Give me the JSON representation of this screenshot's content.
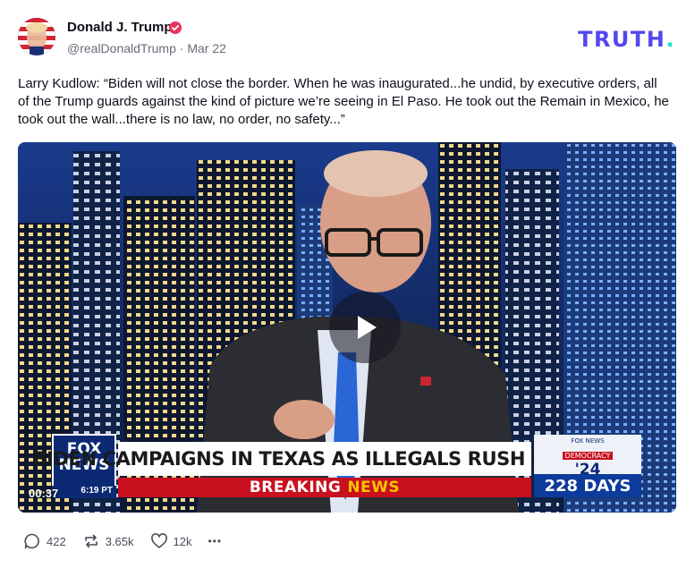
{
  "author": {
    "name": "Donald J. Trump",
    "handle": "@realDonaldTrump",
    "separator": "·",
    "date": "Mar 22"
  },
  "brand": {
    "text": "TRUTH",
    "dot": "."
  },
  "post": {
    "text": "Larry Kudlow: “Biden will not close the border. When he was inaugurated...he undid, by executive orders, all of the Trump guards against the kind of picture we’re seeing in El Paso. He took out the Remain in Mexico, he took out the wall...there is no law, no order, no safety...”"
  },
  "video": {
    "timestamp": "00:37",
    "chyron": {
      "headline": "BIDEN CAMPAIGNS IN TEXAS AS ILLEGALS RUSH BORDER",
      "breaking": "BREAKING",
      "news": "NEWS",
      "logo_line1": "FOX",
      "logo_line2": "NEWS",
      "time": "6:19 PT",
      "box_small": "FOX NEWS",
      "box_label": "DEMOCRACY",
      "box_year": "'24",
      "days": "228 DAYS"
    }
  },
  "actions": {
    "replies": "422",
    "retruths": "3.65k",
    "likes": "12k",
    "more": "•••"
  },
  "colors": {
    "brand": "#5448ee",
    "brand_dot": "#17e3c4",
    "verified": "#e8345a"
  }
}
